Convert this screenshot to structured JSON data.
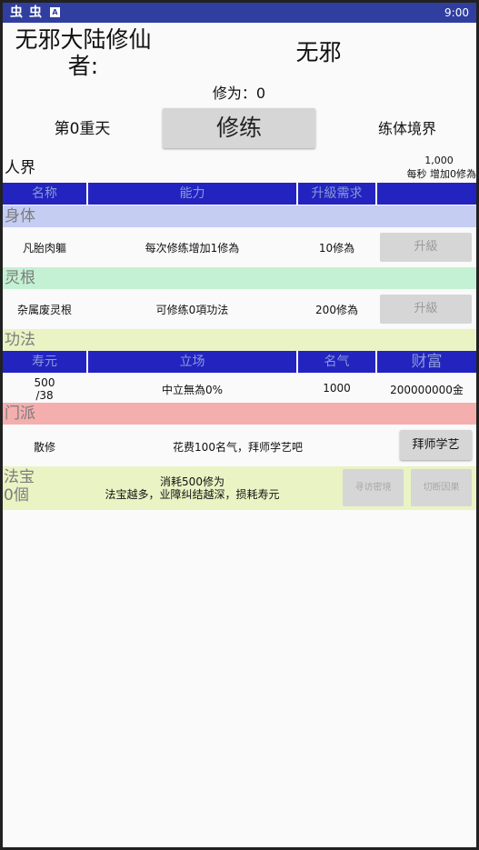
{
  "statusbar": {
    "icon1": "虫",
    "icon2": "虫",
    "icon3": "A",
    "time": "9:00"
  },
  "header": {
    "title": "无邪大陆修仙者:",
    "player_name": "无邪",
    "cultivation": "修为：0",
    "day": "第0重天",
    "practice_button": "修练",
    "realm": "练体境界"
  },
  "world": {
    "name": "人界",
    "value": "1,000",
    "rate": "每秒 增加0修為"
  },
  "table_header": {
    "col1": "名称",
    "col2": "能力",
    "col3": "升級需求",
    "col4": ""
  },
  "body": {
    "section": "身体",
    "name": "凡胎肉軀",
    "ability": "每次修练增加1修為",
    "requirement": "10修為",
    "button": "升級"
  },
  "spirit_root": {
    "section": "灵根",
    "name": "杂属废灵根",
    "ability": "可修练0項功法",
    "requirement": "200修為",
    "button": "升級"
  },
  "technique": {
    "section": "功法"
  },
  "stats_header": {
    "col1": "寿元",
    "col2": "立场",
    "col3": "名气",
    "col4": "财富"
  },
  "stats": {
    "lifespan_top": "500",
    "lifespan_bottom": "/38",
    "stance": "中立無為0%",
    "fame": "1000",
    "wealth": "200000000金"
  },
  "sect": {
    "section": "门派",
    "name": "散修",
    "desc": "花费100名气，拜师学艺吧",
    "button": "拜师学艺"
  },
  "treasure": {
    "label": "法宝",
    "count": "0個",
    "desc1": "消耗500修为",
    "desc2": "法宝越多，业障纠结越深，损耗寿元",
    "button_seek": "寻访密境",
    "button_cut": "切断因果"
  },
  "colors": {
    "statusbar": "#303f9f",
    "table_header": "#2323c0",
    "body_bar": "#c5cdf3",
    "spirit_bar": "#c4f1d3",
    "technique_bar": "#eaf3c3",
    "sect_bar": "#f5aeae",
    "treasure_bar": "#eaf3c3"
  }
}
